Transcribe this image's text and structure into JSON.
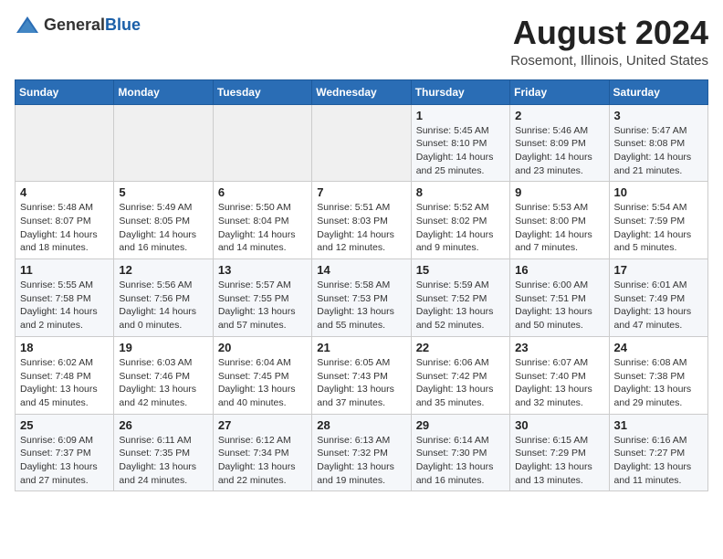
{
  "header": {
    "logo_general": "General",
    "logo_blue": "Blue",
    "title": "August 2024",
    "subtitle": "Rosemont, Illinois, United States"
  },
  "calendar": {
    "headers": [
      "Sunday",
      "Monday",
      "Tuesday",
      "Wednesday",
      "Thursday",
      "Friday",
      "Saturday"
    ],
    "weeks": [
      [
        {
          "day": "",
          "info": ""
        },
        {
          "day": "",
          "info": ""
        },
        {
          "day": "",
          "info": ""
        },
        {
          "day": "",
          "info": ""
        },
        {
          "day": "1",
          "info": "Sunrise: 5:45 AM\nSunset: 8:10 PM\nDaylight: 14 hours\nand 25 minutes."
        },
        {
          "day": "2",
          "info": "Sunrise: 5:46 AM\nSunset: 8:09 PM\nDaylight: 14 hours\nand 23 minutes."
        },
        {
          "day": "3",
          "info": "Sunrise: 5:47 AM\nSunset: 8:08 PM\nDaylight: 14 hours\nand 21 minutes."
        }
      ],
      [
        {
          "day": "4",
          "info": "Sunrise: 5:48 AM\nSunset: 8:07 PM\nDaylight: 14 hours\nand 18 minutes."
        },
        {
          "day": "5",
          "info": "Sunrise: 5:49 AM\nSunset: 8:05 PM\nDaylight: 14 hours\nand 16 minutes."
        },
        {
          "day": "6",
          "info": "Sunrise: 5:50 AM\nSunset: 8:04 PM\nDaylight: 14 hours\nand 14 minutes."
        },
        {
          "day": "7",
          "info": "Sunrise: 5:51 AM\nSunset: 8:03 PM\nDaylight: 14 hours\nand 12 minutes."
        },
        {
          "day": "8",
          "info": "Sunrise: 5:52 AM\nSunset: 8:02 PM\nDaylight: 14 hours\nand 9 minutes."
        },
        {
          "day": "9",
          "info": "Sunrise: 5:53 AM\nSunset: 8:00 PM\nDaylight: 14 hours\nand 7 minutes."
        },
        {
          "day": "10",
          "info": "Sunrise: 5:54 AM\nSunset: 7:59 PM\nDaylight: 14 hours\nand 5 minutes."
        }
      ],
      [
        {
          "day": "11",
          "info": "Sunrise: 5:55 AM\nSunset: 7:58 PM\nDaylight: 14 hours\nand 2 minutes."
        },
        {
          "day": "12",
          "info": "Sunrise: 5:56 AM\nSunset: 7:56 PM\nDaylight: 14 hours\nand 0 minutes."
        },
        {
          "day": "13",
          "info": "Sunrise: 5:57 AM\nSunset: 7:55 PM\nDaylight: 13 hours\nand 57 minutes."
        },
        {
          "day": "14",
          "info": "Sunrise: 5:58 AM\nSunset: 7:53 PM\nDaylight: 13 hours\nand 55 minutes."
        },
        {
          "day": "15",
          "info": "Sunrise: 5:59 AM\nSunset: 7:52 PM\nDaylight: 13 hours\nand 52 minutes."
        },
        {
          "day": "16",
          "info": "Sunrise: 6:00 AM\nSunset: 7:51 PM\nDaylight: 13 hours\nand 50 minutes."
        },
        {
          "day": "17",
          "info": "Sunrise: 6:01 AM\nSunset: 7:49 PM\nDaylight: 13 hours\nand 47 minutes."
        }
      ],
      [
        {
          "day": "18",
          "info": "Sunrise: 6:02 AM\nSunset: 7:48 PM\nDaylight: 13 hours\nand 45 minutes."
        },
        {
          "day": "19",
          "info": "Sunrise: 6:03 AM\nSunset: 7:46 PM\nDaylight: 13 hours\nand 42 minutes."
        },
        {
          "day": "20",
          "info": "Sunrise: 6:04 AM\nSunset: 7:45 PM\nDaylight: 13 hours\nand 40 minutes."
        },
        {
          "day": "21",
          "info": "Sunrise: 6:05 AM\nSunset: 7:43 PM\nDaylight: 13 hours\nand 37 minutes."
        },
        {
          "day": "22",
          "info": "Sunrise: 6:06 AM\nSunset: 7:42 PM\nDaylight: 13 hours\nand 35 minutes."
        },
        {
          "day": "23",
          "info": "Sunrise: 6:07 AM\nSunset: 7:40 PM\nDaylight: 13 hours\nand 32 minutes."
        },
        {
          "day": "24",
          "info": "Sunrise: 6:08 AM\nSunset: 7:38 PM\nDaylight: 13 hours\nand 29 minutes."
        }
      ],
      [
        {
          "day": "25",
          "info": "Sunrise: 6:09 AM\nSunset: 7:37 PM\nDaylight: 13 hours\nand 27 minutes."
        },
        {
          "day": "26",
          "info": "Sunrise: 6:11 AM\nSunset: 7:35 PM\nDaylight: 13 hours\nand 24 minutes."
        },
        {
          "day": "27",
          "info": "Sunrise: 6:12 AM\nSunset: 7:34 PM\nDaylight: 13 hours\nand 22 minutes."
        },
        {
          "day": "28",
          "info": "Sunrise: 6:13 AM\nSunset: 7:32 PM\nDaylight: 13 hours\nand 19 minutes."
        },
        {
          "day": "29",
          "info": "Sunrise: 6:14 AM\nSunset: 7:30 PM\nDaylight: 13 hours\nand 16 minutes."
        },
        {
          "day": "30",
          "info": "Sunrise: 6:15 AM\nSunset: 7:29 PM\nDaylight: 13 hours\nand 13 minutes."
        },
        {
          "day": "31",
          "info": "Sunrise: 6:16 AM\nSunset: 7:27 PM\nDaylight: 13 hours\nand 11 minutes."
        }
      ]
    ]
  }
}
